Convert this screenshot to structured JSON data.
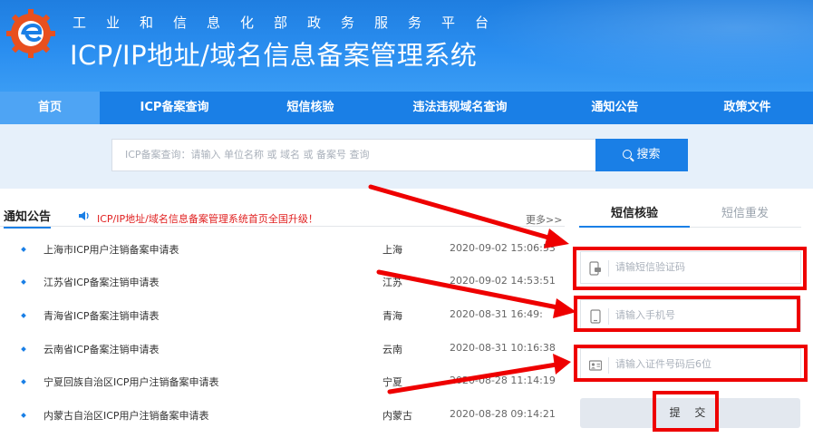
{
  "header": {
    "org_name": "工业和信息化部政务服务平台",
    "system_name": "ICP/IP地址/域名信息备案管理系统"
  },
  "nav": {
    "items": [
      {
        "label": "首页",
        "active": true
      },
      {
        "label": "ICP备案查询",
        "active": false
      },
      {
        "label": "短信核验",
        "active": false
      },
      {
        "label": "违法违规域名查询",
        "active": false
      },
      {
        "label": "通知公告",
        "active": false
      },
      {
        "label": "政策文件",
        "active": false
      }
    ]
  },
  "search": {
    "placeholder": "ICP备案查询：请输入 单位名称 或 域名 或 备案号 查询",
    "button_label": "搜索"
  },
  "notices": {
    "title": "通知公告",
    "marquee": "ICP/IP地址/域名信息备案管理系统首页全国升级！",
    "more_label": "更多>>",
    "rows": [
      {
        "title": "上海市ICP用户注销备案申请表",
        "province": "上海",
        "time": "2020-09-02 15:06:53"
      },
      {
        "title": "江苏省ICP备案注销申请表",
        "province": "江苏",
        "time": "2020-09-02 14:53:51"
      },
      {
        "title": "青海省ICP备案注销申请表",
        "province": "青海",
        "time": "2020-08-31 16:49:"
      },
      {
        "title": "云南省ICP备案注销申请表",
        "province": "云南",
        "time": "2020-08-31 10:16:38"
      },
      {
        "title": "宁夏回族自治区ICP用户注销备案申请表",
        "province": "宁夏",
        "time": "2020-08-28 11:14:19"
      },
      {
        "title": "内蒙古自治区ICP用户注销备案申请表",
        "province": "内蒙古",
        "time": "2020-08-28 09:14:21"
      }
    ]
  },
  "sms_panel": {
    "tab_verify": "短信核验",
    "tab_resend": "短信重发",
    "code_placeholder": "请输短信验证码",
    "phone_placeholder": "请输入手机号",
    "id_placeholder": "请输入证件号码后6位",
    "submit_label": "提 交"
  },
  "colors": {
    "brand_blue": "#1a7fe6",
    "nav_active": "#4ea4f4",
    "annotation_red": "#ee0000",
    "notice_red": "#e02020"
  }
}
